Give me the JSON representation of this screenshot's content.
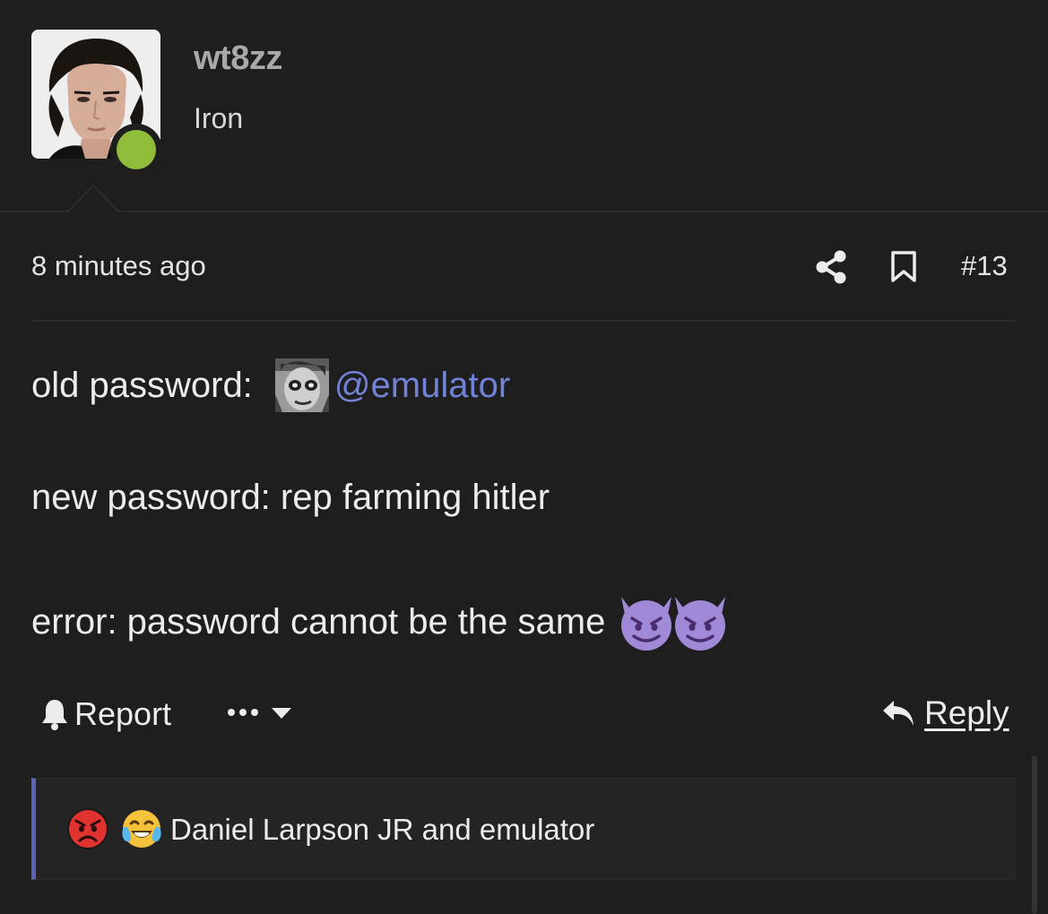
{
  "user": {
    "username": "wt8zz",
    "title": "Iron",
    "status": "online"
  },
  "post": {
    "time": "8 minutes ago",
    "number": "#13",
    "lines": {
      "old_prefix": "old password: ",
      "mention": "@emulator",
      "new_line": "new password: rep farming hitler",
      "error_line": "error: password cannot be the same"
    }
  },
  "actions": {
    "report": "Report",
    "more": "•••",
    "reply": "Reply"
  },
  "reactions": {
    "text": "Daniel Larpson JR and emulator",
    "icons": [
      "angry-face-icon",
      "crying-laughing-face-icon"
    ]
  },
  "colors": {
    "background": "#1e1e1f",
    "mention": "#7283d6",
    "online": "#8fbd3a",
    "reaction_accent": "#5b62b8",
    "devil": "#a08ad8"
  }
}
